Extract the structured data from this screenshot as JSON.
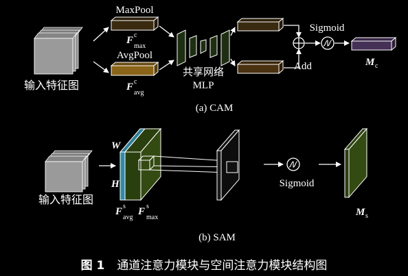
{
  "colors": {
    "background": "#000000",
    "max_feature": "#3a2a10",
    "avg_feature": "#8a6418",
    "mlp": "#1e2e12",
    "merged_feature": "#4a3110",
    "mc_output": "#453056",
    "sam_green": "#334a12",
    "sam_blue": "#2f8ca8",
    "input_card": "#9a9a9a",
    "line": "#ffffff"
  },
  "cam": {
    "input_label": "输入特征图",
    "maxpool_label": "MaxPool",
    "avgpool_label": "AvgPool",
    "fmax_base": "F",
    "fmax_sup": "c",
    "fmax_sub": "max",
    "favg_base": "F",
    "favg_sup": "c",
    "favg_sub": "avg",
    "mlp_label_cn": "共享网络",
    "mlp_label_en": "MLP",
    "sigmoid_label": "Sigmoid",
    "add_label": "Add",
    "output_base": "M",
    "output_sub": "c",
    "caption": "(a)  CAM"
  },
  "sam": {
    "input_label": "输入特征图",
    "w_label": "W",
    "h_label": "H",
    "favg_base": "F",
    "favg_sup": "s",
    "favg_sub": "avg",
    "fmax_base": "F",
    "fmax_sup": "s",
    "fmax_sub": "max",
    "sigmoid_label": "Sigmoid",
    "output_base": "M",
    "output_sub": "s",
    "caption": "(b)  SAM"
  },
  "figure_caption": {
    "number": "图 1",
    "text": "通道注意力模块与空间注意力模块结构图"
  }
}
